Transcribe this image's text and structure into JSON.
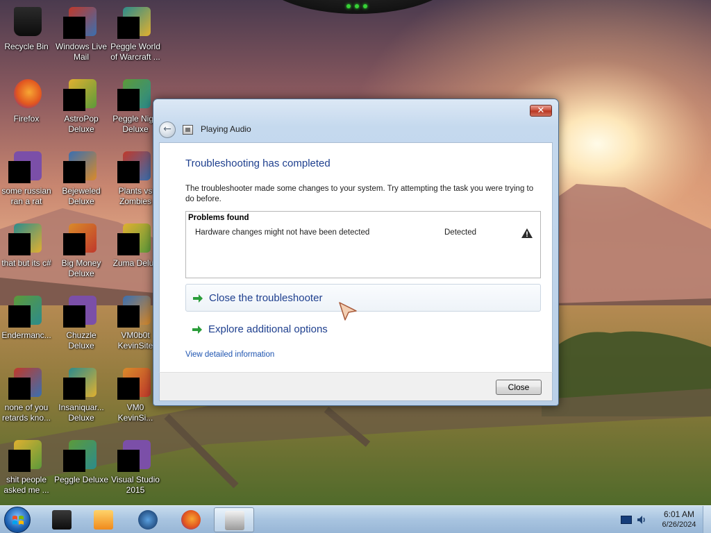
{
  "desktop": {
    "icons": [
      {
        "label": "Recycle Bin",
        "icon": "recycle-bin-icon"
      },
      {
        "label": "Windows Live\nMail",
        "icon": "mail-icon"
      },
      {
        "label": "Peggle World\nof Warcraft ...",
        "icon": "peggle-icon"
      },
      {
        "label": "Firefox",
        "icon": "firefox-icon"
      },
      {
        "label": "AstroPop\nDeluxe",
        "icon": "astropop-icon"
      },
      {
        "label": "Peggle Nigh\nDeluxe",
        "icon": "peggle-nights-icon"
      },
      {
        "label": "some russian\nran a rat",
        "icon": "app-icon"
      },
      {
        "label": "Bejeweled\nDeluxe",
        "icon": "bejeweled-icon"
      },
      {
        "label": "Plants vs\nZombies",
        "icon": "plants-vs-zombies-icon"
      },
      {
        "label": "that but its c#",
        "icon": "shortcut-icon"
      },
      {
        "label": "Big Money\nDeluxe",
        "icon": "big-money-icon"
      },
      {
        "label": "Zuma Delux",
        "icon": "zuma-icon"
      },
      {
        "label": "Endermanc...",
        "icon": "terminal-icon"
      },
      {
        "label": "Chuzzle\nDeluxe",
        "icon": "chuzzle-icon"
      },
      {
        "label": "VM0b0t\nKevinSite",
        "icon": "vm-icon"
      },
      {
        "label": "none of you\nretards kno...",
        "icon": "app-icon"
      },
      {
        "label": "Insaniquar...\nDeluxe",
        "icon": "insaniquarium-icon"
      },
      {
        "label": "VM0\nKevinSi...",
        "icon": "vm-icon"
      },
      {
        "label": "shit people\nasked me ...",
        "icon": "folder-icon"
      },
      {
        "label": "Peggle Deluxe",
        "icon": "peggle-icon"
      },
      {
        "label": "Visual Studio\n2015",
        "icon": "visual-studio-icon"
      }
    ]
  },
  "window": {
    "title": "Playing Audio",
    "close_glyph": "✕",
    "back_glyph": "←",
    "heading": "Troubleshooting has completed",
    "description": "The troubleshooter made some changes to your system. Try attempting the task you were trying to do before.",
    "problems": {
      "title": "Problems found",
      "rows": [
        {
          "text": "Hardware changes might not have been detected",
          "status": "Detected",
          "icon": "warning-icon"
        }
      ]
    },
    "commands": [
      {
        "label": "Close the troubleshooter"
      },
      {
        "label": "Explore additional options"
      }
    ],
    "detail_link": "View detailed information",
    "close_button": "Close"
  },
  "taskbar": {
    "apps": [
      {
        "icon": "recycle-bin-icon"
      },
      {
        "icon": "media-player-icon"
      },
      {
        "icon": "globe-icon"
      },
      {
        "icon": "firefox-icon"
      },
      {
        "icon": "troubleshooter-icon",
        "active": true
      }
    ],
    "clock": {
      "time": "6:01 AM",
      "date": "6/26/2024"
    }
  },
  "colors": {
    "heading": "#1e3f8e",
    "link": "#1e54b0",
    "command_arrow": "#2a9d3a",
    "taskbar": "#a8c4e0"
  }
}
